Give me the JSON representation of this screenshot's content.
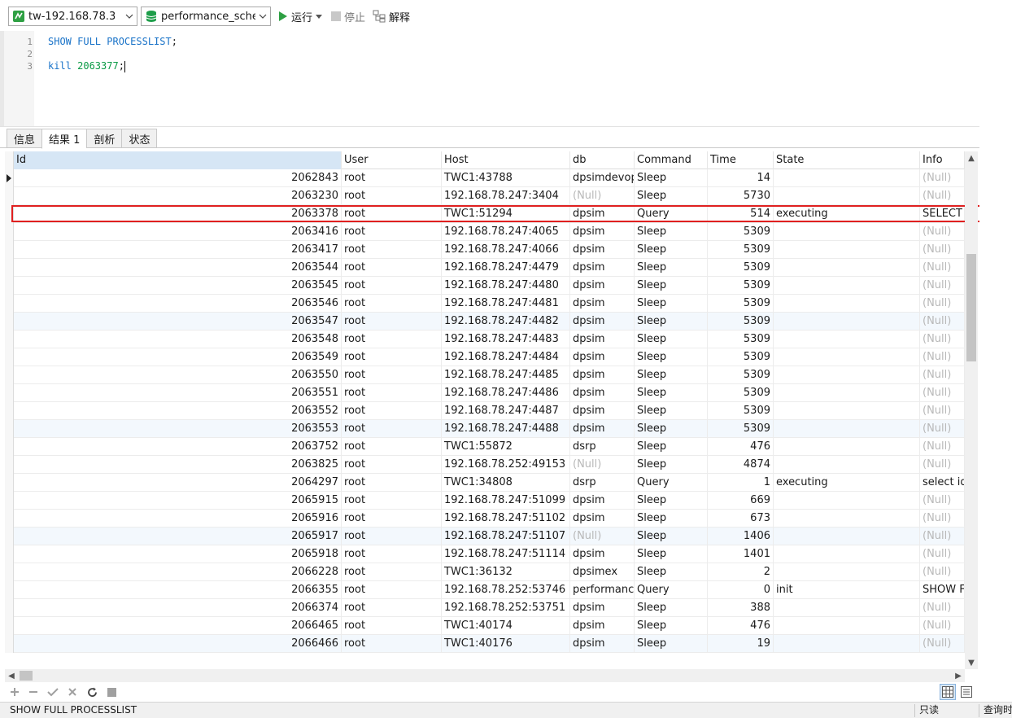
{
  "toolbar": {
    "connection": "tw-192.168.78.3",
    "database": "performance_schema",
    "run_label": "运行",
    "stop_label": "停止",
    "explain_label": "解释",
    "colors": {
      "run": "#2ea043",
      "connection_icon": "#2ea043",
      "database_icon": "#1e9e4a"
    }
  },
  "editor": {
    "lines": [
      {
        "num": "1",
        "parts": [
          {
            "t": "SHOW FULL PROCESSLIST",
            "c": "kw"
          },
          {
            "t": ";",
            "c": ""
          }
        ]
      },
      {
        "num": "2",
        "parts": []
      },
      {
        "num": "3",
        "parts": [
          {
            "t": "kill ",
            "c": "kw"
          },
          {
            "t": "2063377",
            "c": "num"
          },
          {
            "t": ";",
            "c": ""
          }
        ]
      }
    ]
  },
  "tabs": [
    {
      "label": "信息",
      "active": false
    },
    {
      "label": "结果 1",
      "active": true
    },
    {
      "label": "剖析",
      "active": false
    },
    {
      "label": "状态",
      "active": false
    }
  ],
  "grid": {
    "columns": [
      "Id",
      "User",
      "Host",
      "db",
      "Command",
      "Time",
      "State",
      "Info"
    ],
    "null_text": "(Null)",
    "rows": [
      [
        "2062843",
        "root",
        "TWC1:43788",
        "dpsimdevops",
        "Sleep",
        "14",
        "",
        null
      ],
      [
        "2063230",
        "root",
        "192.168.78.247:3404",
        null,
        "Sleep",
        "5730",
        "",
        null
      ],
      [
        "2063378",
        "root",
        "TWC1:51294",
        "dpsim",
        "Query",
        "514",
        "executing",
        "SELECT"
      ],
      [
        "2063416",
        "root",
        "192.168.78.247:4065",
        "dpsim",
        "Sleep",
        "5309",
        "",
        null
      ],
      [
        "2063417",
        "root",
        "192.168.78.247:4066",
        "dpsim",
        "Sleep",
        "5309",
        "",
        null
      ],
      [
        "2063544",
        "root",
        "192.168.78.247:4479",
        "dpsim",
        "Sleep",
        "5309",
        "",
        null
      ],
      [
        "2063545",
        "root",
        "192.168.78.247:4480",
        "dpsim",
        "Sleep",
        "5309",
        "",
        null
      ],
      [
        "2063546",
        "root",
        "192.168.78.247:4481",
        "dpsim",
        "Sleep",
        "5309",
        "",
        null
      ],
      [
        "2063547",
        "root",
        "192.168.78.247:4482",
        "dpsim",
        "Sleep",
        "5309",
        "",
        null
      ],
      [
        "2063548",
        "root",
        "192.168.78.247:4483",
        "dpsim",
        "Sleep",
        "5309",
        "",
        null
      ],
      [
        "2063549",
        "root",
        "192.168.78.247:4484",
        "dpsim",
        "Sleep",
        "5309",
        "",
        null
      ],
      [
        "2063550",
        "root",
        "192.168.78.247:4485",
        "dpsim",
        "Sleep",
        "5309",
        "",
        null
      ],
      [
        "2063551",
        "root",
        "192.168.78.247:4486",
        "dpsim",
        "Sleep",
        "5309",
        "",
        null
      ],
      [
        "2063552",
        "root",
        "192.168.78.247:4487",
        "dpsim",
        "Sleep",
        "5309",
        "",
        null
      ],
      [
        "2063553",
        "root",
        "192.168.78.247:4488",
        "dpsim",
        "Sleep",
        "5309",
        "",
        null
      ],
      [
        "2063752",
        "root",
        "TWC1:55872",
        "dsrp",
        "Sleep",
        "476",
        "",
        null
      ],
      [
        "2063825",
        "root",
        "192.168.78.252:49153",
        null,
        "Sleep",
        "4874",
        "",
        null
      ],
      [
        "2064297",
        "root",
        "TWC1:34808",
        "dsrp",
        "Query",
        "1",
        "executing",
        "select id"
      ],
      [
        "2065915",
        "root",
        "192.168.78.247:51099",
        "dpsim",
        "Sleep",
        "669",
        "",
        null
      ],
      [
        "2065916",
        "root",
        "192.168.78.247:51102",
        "dpsim",
        "Sleep",
        "673",
        "",
        null
      ],
      [
        "2065917",
        "root",
        "192.168.78.247:51107",
        null,
        "Sleep",
        "1406",
        "",
        null
      ],
      [
        "2065918",
        "root",
        "192.168.78.247:51114",
        "dpsim",
        "Sleep",
        "1401",
        "",
        null
      ],
      [
        "2066228",
        "root",
        "TWC1:36132",
        "dpsimex",
        "Sleep",
        "2",
        "",
        null
      ],
      [
        "2066355",
        "root",
        "192.168.78.252:53746",
        "performance_",
        "Query",
        "0",
        "init",
        "SHOW FU"
      ],
      [
        "2066374",
        "root",
        "192.168.78.252:53751",
        "dpsim",
        "Sleep",
        "388",
        "",
        null
      ],
      [
        "2066465",
        "root",
        "TWC1:40174",
        "dpsim",
        "Sleep",
        "476",
        "",
        null
      ],
      [
        "2066466",
        "root",
        "TWC1:40176",
        "dpsim",
        "Sleep",
        "19",
        "",
        null
      ]
    ]
  },
  "statusbar": {
    "sql": "SHOW FULL PROCESSLIST",
    "mode": "只读",
    "query_time": "查询时"
  }
}
